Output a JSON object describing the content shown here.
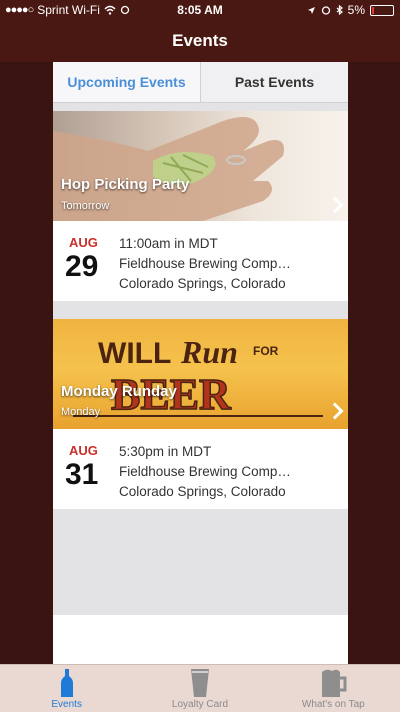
{
  "status": {
    "carrier": "Sprint Wi-Fi",
    "time": "8:05 AM",
    "battery": "5%"
  },
  "nav": {
    "title": "Events"
  },
  "segments": {
    "upcoming": "Upcoming Events",
    "past": "Past Events"
  },
  "events": [
    {
      "title": "Hop Picking Party",
      "subtitle": "Tomorrow",
      "month": "AUG",
      "day": "29",
      "time": "11:00am in MDT",
      "venue": "Fieldhouse Brewing Comp…",
      "location": "Colorado Springs, Colorado"
    },
    {
      "title": "Monday Runday",
      "subtitle": "Monday",
      "month": "AUG",
      "day": "31",
      "time": "5:30pm in MDT",
      "venue": "Fieldhouse Brewing Comp…",
      "location": "Colorado Springs, Colorado",
      "banner_art": {
        "word1": "WILL",
        "word2": "Run",
        "word3": "FOR",
        "word4": "BEER"
      }
    }
  ],
  "tabs": [
    {
      "label": "Events",
      "icon": "bottle-icon",
      "active": true
    },
    {
      "label": "Loyalty Card",
      "icon": "pint-glass-icon",
      "active": false
    },
    {
      "label": "What's on Tap",
      "icon": "beer-mug-icon",
      "active": false
    }
  ],
  "colors": {
    "nav_bg": "#4a1812",
    "accent_blue": "#4a8fd8",
    "month_red": "#c9302c"
  }
}
